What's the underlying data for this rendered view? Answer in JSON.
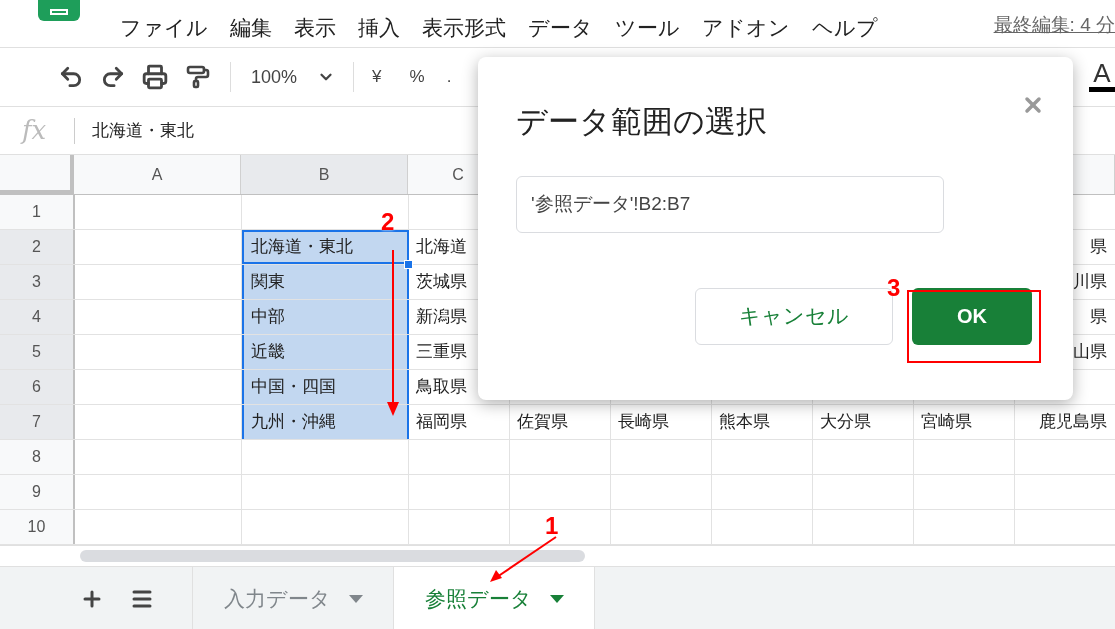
{
  "menu": [
    "ファイル",
    "編集",
    "表示",
    "挿入",
    "表示形式",
    "データ",
    "ツール",
    "アドオン",
    "ヘルプ"
  ],
  "last_edit": "最終編集: 4 分",
  "toolbar": {
    "zoom": "100%",
    "currency": "¥",
    "percent": "%",
    "decimal": ".",
    "text_color": "A"
  },
  "formula_bar": {
    "fx": "fx",
    "value": "北海道・東北"
  },
  "grid": {
    "columns": [
      "A",
      "B",
      "C"
    ],
    "rows": [
      {
        "number": "1",
        "selected": false,
        "cells": [
          null,
          null,
          null,
          null,
          null,
          null,
          null,
          null,
          null
        ]
      },
      {
        "number": "2",
        "selected": true,
        "cells": [
          null,
          {
            "text": "北海道・東北",
            "selected": true,
            "active": true
          },
          {
            "text": "北海道",
            "selected": false,
            "active": false
          },
          null,
          null,
          null,
          null,
          null,
          {
            "text": "県",
            "selected": false,
            "active": false
          }
        ]
      },
      {
        "number": "3",
        "selected": true,
        "cells": [
          null,
          {
            "text": "関東",
            "selected": true,
            "active": false
          },
          {
            "text": "茨城県",
            "selected": false,
            "active": false
          },
          null,
          null,
          null,
          null,
          null,
          {
            "text": "川県",
            "selected": false,
            "active": false
          }
        ]
      },
      {
        "number": "4",
        "selected": true,
        "cells": [
          null,
          {
            "text": "中部",
            "selected": true,
            "active": false
          },
          {
            "text": "新潟県",
            "selected": false,
            "active": false
          },
          null,
          null,
          null,
          null,
          null,
          {
            "text": "県",
            "selected": false,
            "active": false
          }
        ]
      },
      {
        "number": "5",
        "selected": true,
        "cells": [
          null,
          {
            "text": "近畿",
            "selected": true,
            "active": false
          },
          {
            "text": "三重県",
            "selected": false,
            "active": false
          },
          null,
          null,
          null,
          null,
          null,
          {
            "text": "山県",
            "selected": false,
            "active": false
          }
        ]
      },
      {
        "number": "6",
        "selected": true,
        "cells": [
          null,
          {
            "text": "中国・四国",
            "selected": true,
            "active": false
          },
          {
            "text": "鳥取県",
            "selected": false,
            "active": false
          },
          null,
          null,
          null,
          null,
          null,
          null
        ]
      },
      {
        "number": "7",
        "selected": true,
        "cells": [
          null,
          {
            "text": "九州・沖縄",
            "selected": true,
            "active": false
          },
          {
            "text": "福岡県",
            "selected": false,
            "active": false
          },
          {
            "text": "佐賀県",
            "selected": false,
            "active": false
          },
          {
            "text": "長崎県",
            "selected": false,
            "active": false
          },
          {
            "text": "熊本県",
            "selected": false,
            "active": false
          },
          {
            "text": "大分県",
            "selected": false,
            "active": false
          },
          {
            "text": "宮崎県",
            "selected": false,
            "active": false
          },
          {
            "text": "鹿児島県",
            "selected": false,
            "active": false
          }
        ]
      },
      {
        "number": "8",
        "selected": false,
        "cells": [
          null,
          null,
          null,
          null,
          null,
          null,
          null,
          null,
          null
        ]
      },
      {
        "number": "9",
        "selected": false,
        "cells": [
          null,
          null,
          null,
          null,
          null,
          null,
          null,
          null,
          null
        ]
      },
      {
        "number": "10",
        "selected": false,
        "cells": [
          null,
          null,
          null,
          null,
          null,
          null,
          null,
          null,
          null
        ]
      }
    ]
  },
  "sheet_tabs": [
    {
      "label": "入力データ",
      "selected": false
    },
    {
      "label": "参照データ",
      "selected": true
    }
  ],
  "dialog": {
    "title": "データ範囲の選択",
    "range_value": "'参照データ'!B2:B7",
    "buttons": [
      {
        "label": "キャンセル",
        "kind": "secondary"
      },
      {
        "label": "OK",
        "kind": "primary"
      }
    ]
  },
  "step_marks": [
    "1",
    "2",
    "3"
  ]
}
